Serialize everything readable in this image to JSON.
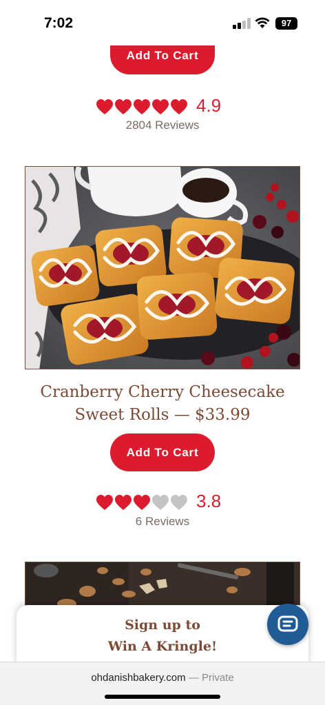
{
  "status_bar": {
    "time": "7:02",
    "battery": "97"
  },
  "previous_product": {
    "cart_label": "Add To Cart",
    "rating": {
      "hearts_filled": 5,
      "value": "4.9",
      "reviews": "2804 Reviews"
    }
  },
  "product": {
    "title_line1": "Cranberry Cherry Cheesecake",
    "title_line2": "Sweet Rolls — $33.99",
    "cart_label": "Add To Cart",
    "rating": {
      "hearts_filled": 3.5,
      "value": "3.8",
      "reviews": "6 Reviews"
    }
  },
  "signup_banner": {
    "line1": "Sign up to",
    "line2": "Win A Kringle!"
  },
  "browser": {
    "domain": "ohdanishbakery.com",
    "private_label": "— Private"
  },
  "icons": {
    "chat": "chat-bubble-icon",
    "heart": "heart-icon",
    "signal": "cellular-signal-icon",
    "wifi": "wifi-icon",
    "battery": "battery-icon"
  },
  "colors": {
    "accent": "#dc1c2e",
    "title_brown": "#7b4a36",
    "chat_blue": "#1f5b94",
    "heart_empty": "#c4c4c4"
  }
}
